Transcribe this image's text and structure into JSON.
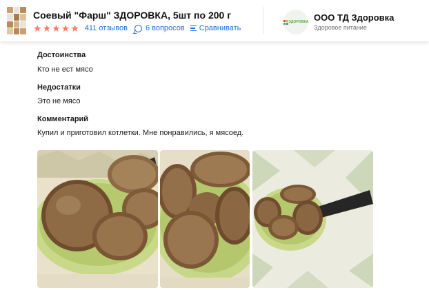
{
  "header": {
    "product_title": "Соевый \"Фарш\" ЗДОРОВКА, 5шт по 200 г",
    "rating_stars": 5,
    "reviews_link": "411 отзывов",
    "questions_link": "6 вопросов",
    "compare_link": "Сравнивать",
    "seller": {
      "logo_text": "ЗДОРОВКА",
      "name": "ООО ТД Здоровка",
      "subtitle": "Здоровое питание"
    }
  },
  "review": {
    "pros_label": "Достоинства",
    "pros_text": "Кто не ест мясо",
    "cons_label": "Недостатки",
    "cons_text": "Это не мясо",
    "comment_label": "Комментарий",
    "comment_text": "Купил и приготовил котлетки. Мне понравились, я мясоед.",
    "photos": [
      "photo-1",
      "photo-2",
      "photo-3"
    ]
  },
  "colors": {
    "star": "#f97b61",
    "link": "#1f6fe0",
    "logo_green": "#5aa83c"
  }
}
